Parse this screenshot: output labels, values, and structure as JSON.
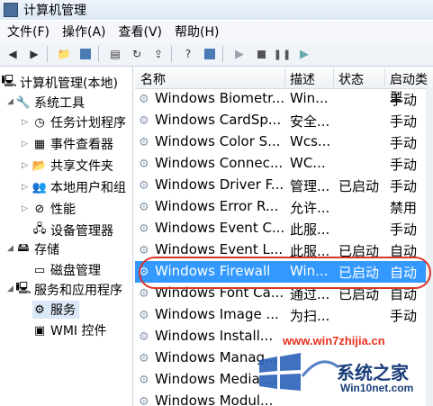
{
  "window": {
    "title": "计算机管理"
  },
  "menu": [
    "文件(F)",
    "操作(A)",
    "查看(V)",
    "帮助(H)"
  ],
  "tree": {
    "root": "计算机管理(本地)",
    "system_tools": "系统工具",
    "items": [
      "任务计划程序",
      "事件查看器",
      "共享文件夹",
      "本地用户和组",
      "性能",
      "设备管理器"
    ],
    "storage": "存储",
    "storage_items": [
      "磁盘管理"
    ],
    "services_apps": "服务和应用程序",
    "services_items": [
      "服务",
      "WMI 控件"
    ]
  },
  "columns": [
    "名称",
    "描述",
    "状态",
    "启动类型"
  ],
  "rows": [
    {
      "name": "Windows Biometr...",
      "desc": "Win...",
      "status": "",
      "startup": "手动"
    },
    {
      "name": "Windows CardSp...",
      "desc": "安全...",
      "status": "",
      "startup": "手动"
    },
    {
      "name": "Windows Color S...",
      "desc": "Wcs...",
      "status": "",
      "startup": "手动"
    },
    {
      "name": "Windows Connec...",
      "desc": "WC...",
      "status": "",
      "startup": "手动"
    },
    {
      "name": "Windows Driver F...",
      "desc": "管理...",
      "status": "已启动",
      "startup": "手动"
    },
    {
      "name": "Windows Error R...",
      "desc": "允许...",
      "status": "",
      "startup": "禁用"
    },
    {
      "name": "Windows Event C...",
      "desc": "此服...",
      "status": "",
      "startup": "手动"
    },
    {
      "name": "Windows Event L...",
      "desc": "此服...",
      "status": "已启动",
      "startup": "自动"
    },
    {
      "name": "Windows Firewall",
      "desc": "Win...",
      "status": "已启动",
      "startup": "自动"
    },
    {
      "name": "Windows Font Ca...",
      "desc": "通过...",
      "status": "已启动",
      "startup": "自动"
    },
    {
      "name": "Windows Image ...",
      "desc": "为扫...",
      "status": "",
      "startup": "手动"
    },
    {
      "name": "Windows Install...",
      "desc": "",
      "status": "",
      "startup": ""
    },
    {
      "name": "Windows Manag...",
      "desc": "",
      "status": "",
      "startup": ""
    },
    {
      "name": "Windows Media ...",
      "desc": "",
      "status": "",
      "startup": ""
    },
    {
      "name": "Windows Modul...",
      "desc": "",
      "status": "",
      "startup": ""
    }
  ],
  "selected_row": 8,
  "watermark": {
    "line1": "www.win7zhijia.cn",
    "line2": "系统之家",
    "line3": "Win10net.com"
  },
  "colors": {
    "selection": "#3399ff",
    "highlight_oval": "#d9342b"
  }
}
